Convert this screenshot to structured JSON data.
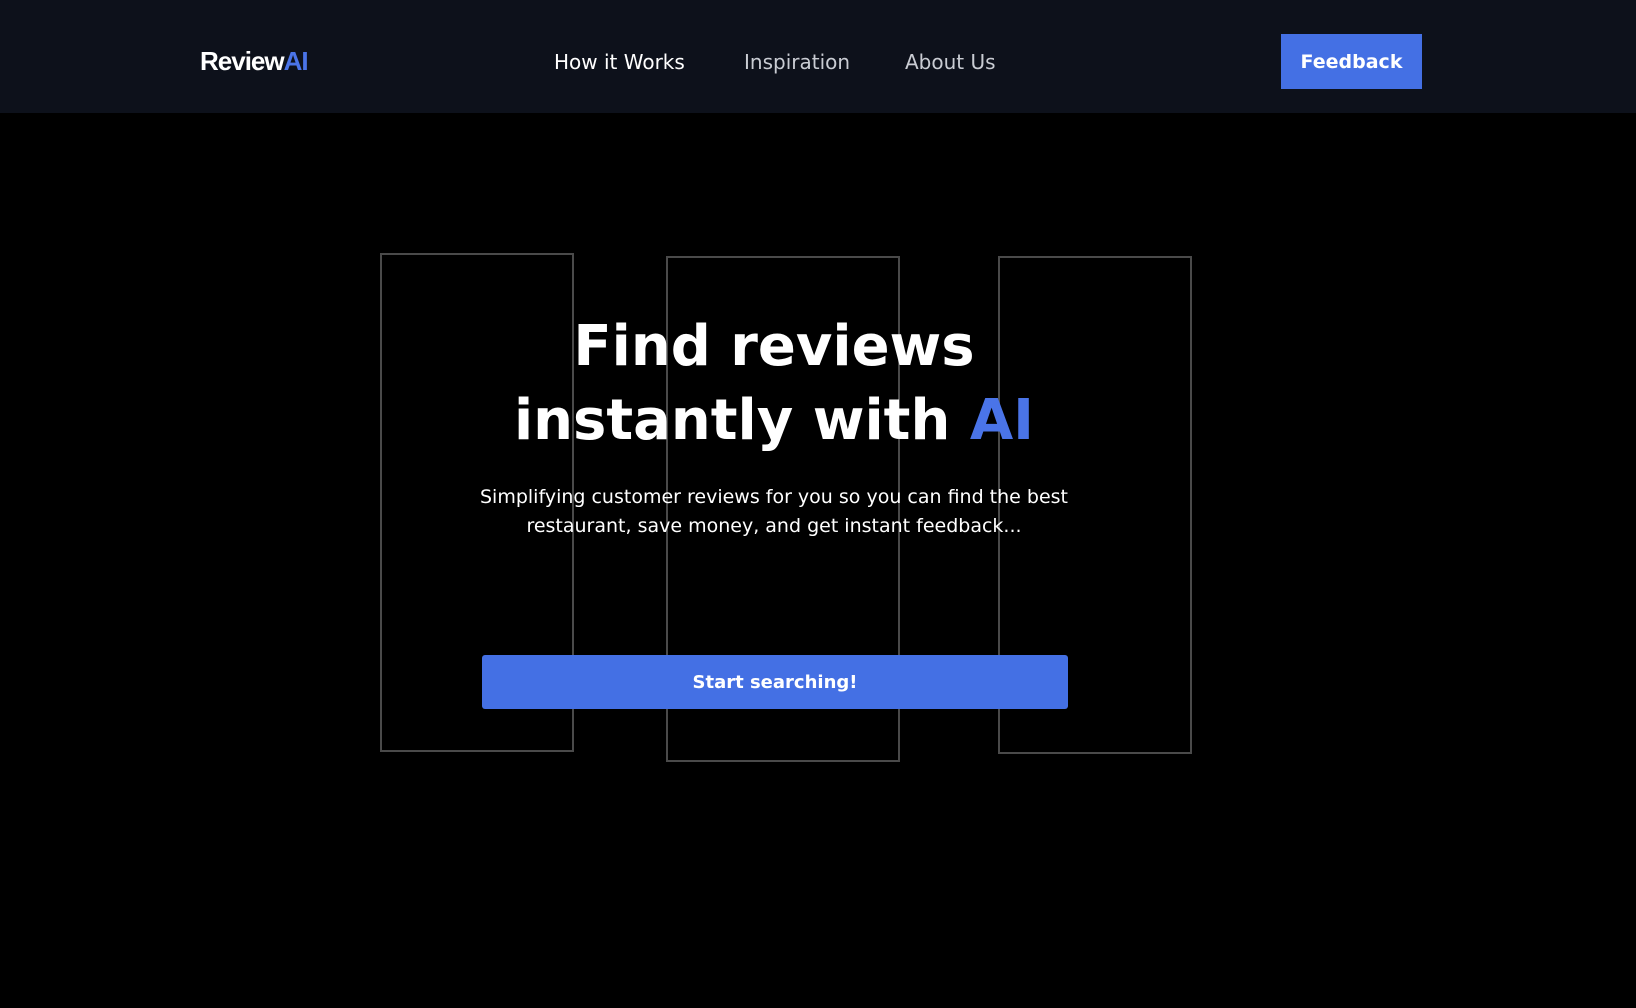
{
  "nav": {
    "logo_main": "Review",
    "logo_accent": "AI",
    "links": [
      {
        "label": "How it Works",
        "active": true
      },
      {
        "label": "Inspiration",
        "active": false
      },
      {
        "label": "About Us",
        "active": false
      }
    ],
    "feedback_label": "Feedback"
  },
  "hero": {
    "title_line1": "Find reviews",
    "title_line2_prefix": "instantly with ",
    "title_line2_accent": "AI",
    "subtitle": "Simplifying customer reviews for you so you can find the best restaurant, save money, and get instant feedback...",
    "cta_label": "Start searching!"
  },
  "colors": {
    "accent": "#4470e4",
    "nav_background": "#0d111b",
    "page_background": "#000000"
  }
}
